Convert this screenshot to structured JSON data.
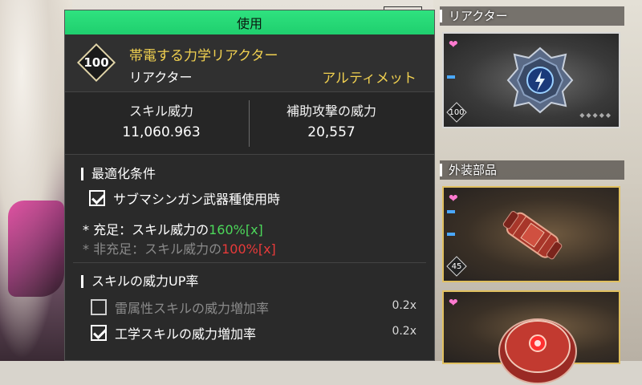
{
  "header": {
    "title": "使用"
  },
  "item": {
    "level": "100",
    "name": "帯電する力学リアクター",
    "type": "リアクター",
    "rarity": "アルティメット"
  },
  "stats": {
    "skill_power_label": "スキル威力",
    "skill_power_value": "11,060.963",
    "support_power_label": "補助攻撃の威力",
    "support_power_value": "20,557"
  },
  "optimization": {
    "title": "最適化条件",
    "condition": {
      "label": "サブマシンガン武器種使用時",
      "checked": true
    },
    "met_prefix": "* 充足：スキル威力の",
    "met_value": "160%[x]",
    "unmet_prefix": "* 非充足：スキル威力の",
    "unmet_value": "100%[x]"
  },
  "skill_up": {
    "title": "スキルの威力UP率",
    "rows": [
      {
        "label": "雷属性スキルの威力増加率",
        "value": "0.2x",
        "checked": false
      },
      {
        "label": "工学スキルの威力増加率",
        "value": "0.2x",
        "checked": true
      }
    ]
  },
  "inventory": {
    "reactor_title": "リアクター",
    "parts_title": "外装部品",
    "reactor_card": {
      "level": "100",
      "dots": "◆◆◆◆◆"
    },
    "parts_cards": [
      {
        "level": "45"
      },
      {
        "level": ""
      }
    ]
  },
  "colors": {
    "header_green": "#1fcf6e",
    "gold": "#f0d050",
    "met_green": "#4cd85a",
    "unmet_red": "#e83a3a"
  }
}
